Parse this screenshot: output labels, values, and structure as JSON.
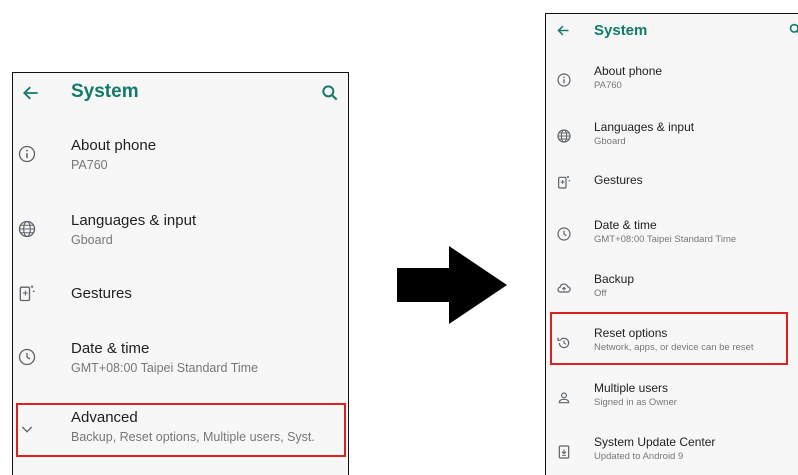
{
  "left": {
    "title": "System",
    "items": [
      {
        "icon": "info-icon",
        "title": "About phone",
        "subtitle": "PA760"
      },
      {
        "icon": "globe-icon",
        "title": "Languages & input",
        "subtitle": "Gboard"
      },
      {
        "icon": "gestures-icon",
        "title": "Gestures",
        "subtitle": ""
      },
      {
        "icon": "clock-icon",
        "title": "Date & time",
        "subtitle": "GMT+08:00 Taipei Standard Time"
      },
      {
        "icon": "chevron-down-icon",
        "title": "Advanced",
        "subtitle": "Backup, Reset options, Multiple users, Syst."
      }
    ]
  },
  "right": {
    "title": "System",
    "items": [
      {
        "icon": "info-icon",
        "title": "About phone",
        "subtitle": "PA760"
      },
      {
        "icon": "globe-icon",
        "title": "Languages & input",
        "subtitle": "Gboard"
      },
      {
        "icon": "gestures-icon",
        "title": "Gestures",
        "subtitle": ""
      },
      {
        "icon": "clock-icon",
        "title": "Date & time",
        "subtitle": "GMT+08:00 Taipei Standard Time"
      },
      {
        "icon": "backup-icon",
        "title": "Backup",
        "subtitle": "Off"
      },
      {
        "icon": "reset-icon",
        "title": "Reset options",
        "subtitle": "Network, apps, or device can be reset"
      },
      {
        "icon": "person-icon",
        "title": "Multiple users",
        "subtitle": "Signed in as Owner"
      },
      {
        "icon": "system-update-icon",
        "title": "System Update Center",
        "subtitle": "Updated to Android 9"
      }
    ]
  },
  "colors": {
    "accent": "#137a6b",
    "highlight": "#e02020",
    "icon": "#5f6368"
  }
}
